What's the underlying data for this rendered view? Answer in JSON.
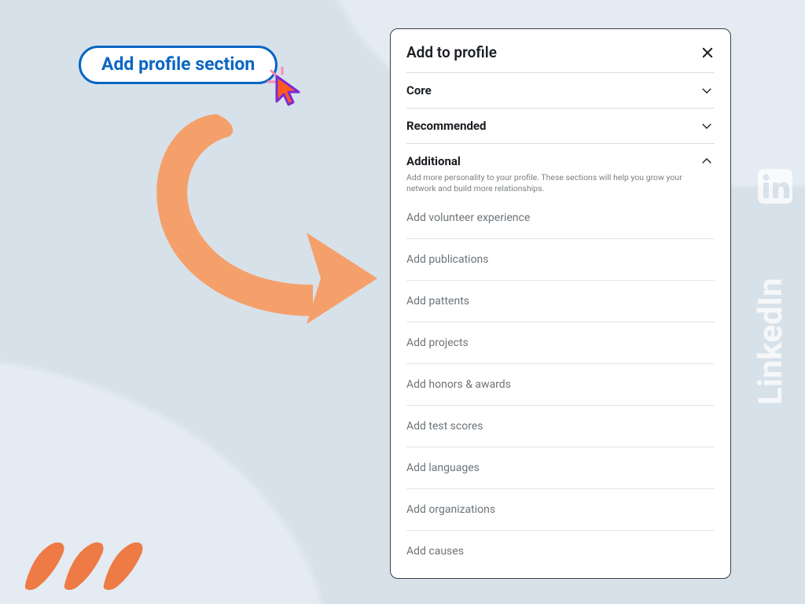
{
  "button": {
    "label": "Add profile section"
  },
  "panel": {
    "title": "Add to profile",
    "close_label": "Close",
    "sections": {
      "core": {
        "title": "Core",
        "expanded": false
      },
      "recommended": {
        "title": "Recommended",
        "expanded": false
      },
      "additional": {
        "title": "Additional",
        "expanded": true,
        "description": "Add more personality to your profile. These sections will help you  grow your network and build more relationships.",
        "items": [
          "Add volunteer experience",
          "Add publications",
          "Add pattents",
          "Add projects",
          "Add honors & awards",
          "Add test scores",
          "Add languages",
          "Add organizations",
          "Add causes"
        ]
      }
    }
  },
  "brand": {
    "linkedin_label": "LinkedIn"
  },
  "colors": {
    "accent": "#0a66c2",
    "arrow": "#f5a06a",
    "cursor_fill": "#ff5a1f",
    "cursor_stroke": "#7a2bd6",
    "panel_border": "#3a3f45"
  }
}
